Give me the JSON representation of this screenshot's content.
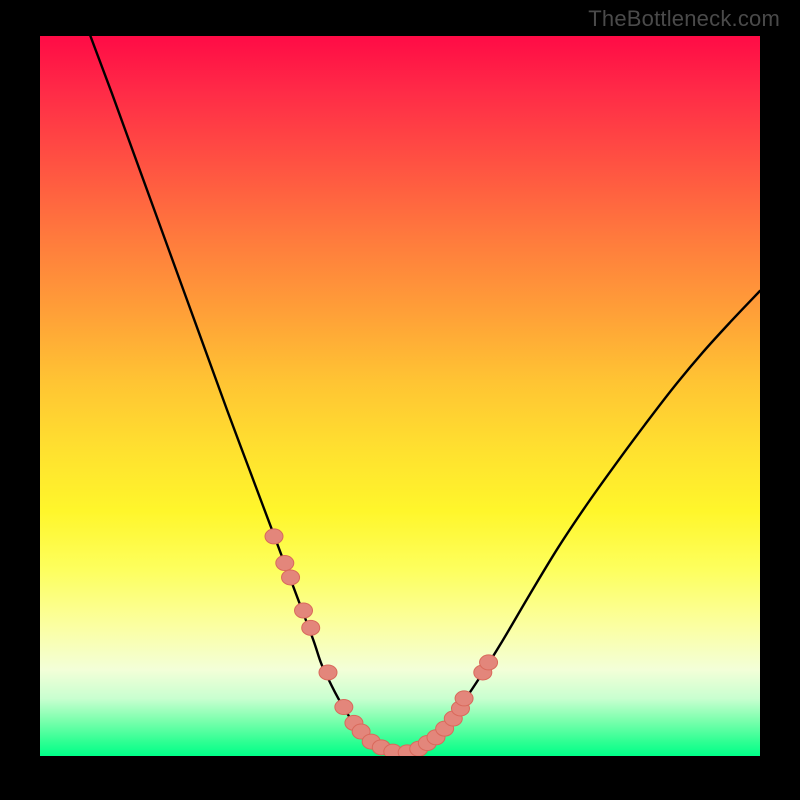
{
  "watermark": "TheBottleneck.com",
  "colors": {
    "curve": "#000000",
    "marker_fill": "#e3867b",
    "marker_stroke": "#d9695b"
  },
  "chart_data": {
    "type": "line",
    "title": "",
    "xlabel": "",
    "ylabel": "",
    "xlim": [
      0,
      100
    ],
    "ylim": [
      0,
      100
    ],
    "grid": false,
    "legend": false,
    "note": "No axis labels, ticks, or legend are present in the image. Values are normalized 0–100 in both axes as estimated from pixel positions.",
    "series": [
      {
        "name": "left-curve",
        "x": [
          7,
          10,
          14,
          18,
          22,
          26,
          29,
          32,
          33.5,
          35,
          36.5,
          38,
          39,
          40,
          41,
          42,
          43,
          43.8,
          44.6,
          45.4,
          46.2,
          47
        ],
        "y": [
          100,
          92,
          81,
          70,
          59,
          48,
          40,
          32,
          28,
          24,
          20,
          16,
          13,
          10.8,
          8.8,
          7,
          5.4,
          4.2,
          3.2,
          2.4,
          1.6,
          1.0
        ]
      },
      {
        "name": "valley-floor",
        "x": [
          47,
          48,
          49,
          50,
          51,
          52,
          53.5
        ],
        "y": [
          1.0,
          0.6,
          0.4,
          0.3,
          0.4,
          0.6,
          1.0
        ]
      },
      {
        "name": "right-curve",
        "x": [
          53.5,
          55,
          57,
          59,
          61,
          64,
          68,
          72,
          76,
          80,
          84,
          88,
          92,
          96,
          100
        ],
        "y": [
          1.0,
          2.6,
          5.0,
          7.8,
          10.8,
          15.6,
          22.4,
          29.0,
          35.0,
          40.6,
          46.0,
          51.2,
          56.0,
          60.4,
          64.6
        ]
      }
    ],
    "markers": {
      "name": "highlighted-points",
      "x": [
        32.5,
        34.0,
        34.8,
        36.6,
        37.6,
        40.0,
        42.2,
        43.6,
        44.6,
        46.0,
        47.4,
        49.0,
        51.0,
        52.6,
        53.8,
        55.0,
        56.2,
        57.4,
        58.4,
        58.9,
        61.5,
        62.3
      ],
      "y": [
        30.5,
        26.8,
        24.8,
        20.2,
        17.8,
        11.6,
        6.8,
        4.6,
        3.4,
        2.0,
        1.2,
        0.6,
        0.5,
        1.0,
        1.8,
        2.6,
        3.8,
        5.2,
        6.6,
        8.0,
        11.6,
        13.0
      ]
    }
  }
}
